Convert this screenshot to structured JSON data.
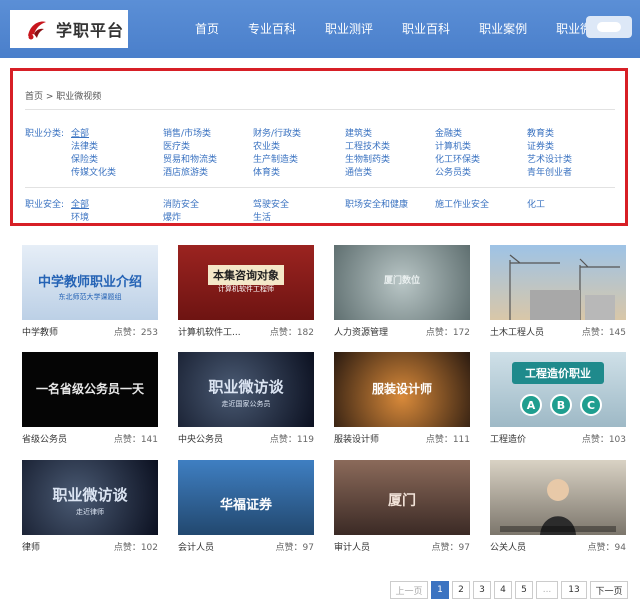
{
  "header": {
    "brand": "学职平台",
    "nav": [
      "首页",
      "专业百科",
      "职业测评",
      "职业百科",
      "职业案例",
      "职业微视频"
    ],
    "accent": "#4a7fcb"
  },
  "breadcrumb": "首页 > 职业微视频",
  "filters": {
    "category_label": "职业分类:",
    "category_items": [
      "全部",
      "销售/市场类",
      "财务/行政类",
      "建筑类",
      "金融类",
      "教育类",
      "法律类",
      "医疗类",
      "农业类",
      "工程技术类",
      "计算机类",
      "证券类",
      "保险类",
      "贸易和物流类",
      "生产制造类",
      "生物制药类",
      "化工环保类",
      "艺术设计类",
      "传媒文化类",
      "酒店旅游类",
      "体育类",
      "通信类",
      "公务员类",
      "青年创业者"
    ],
    "safety_label": "职业安全:",
    "safety_items": [
      "全部",
      "消防安全",
      "驾驶安全",
      "职场安全和健康",
      "施工作业安全",
      "化工",
      "环境",
      "爆炸",
      "生活"
    ],
    "highlight_color": "#d71f26"
  },
  "videos": [
    {
      "title": "中学教师",
      "likes": "点赞：253",
      "thumb_text": "中学教师职业介绍",
      "thumb_sub": "东北师范大学课题组"
    },
    {
      "title": "计算机软件工...",
      "likes": "点赞：182",
      "thumb_text": "本集咨询对象",
      "thumb_sub": "计算机软件工程师"
    },
    {
      "title": "人力资源管理",
      "likes": "点赞：172",
      "thumb_text": "厦门数位",
      "thumb_sub": ""
    },
    {
      "title": "土木工程人员",
      "likes": "点赞：145",
      "thumb_text": "",
      "thumb_sub": ""
    },
    {
      "title": "省级公务员",
      "likes": "点赞：141",
      "thumb_text": "一名省级公务员一天",
      "thumb_sub": ""
    },
    {
      "title": "中央公务员",
      "likes": "点赞：119",
      "thumb_text": "职业微访谈",
      "thumb_sub": "走近国家公务员"
    },
    {
      "title": "服装设计师",
      "likes": "点赞：111",
      "thumb_text": "服装设计师",
      "thumb_sub": ""
    },
    {
      "title": "工程造价",
      "likes": "点赞：103",
      "thumb_text": "工程造价职业",
      "thumb_sub": ""
    },
    {
      "title": "律师",
      "likes": "点赞：102",
      "thumb_text": "职业微访谈",
      "thumb_sub": "走近律师"
    },
    {
      "title": "会计人员",
      "likes": "点赞：97",
      "thumb_text": "华福证券",
      "thumb_sub": ""
    },
    {
      "title": "审计人员",
      "likes": "点赞：97",
      "thumb_text": "厦门",
      "thumb_sub": ""
    },
    {
      "title": "公关人员",
      "likes": "点赞：94",
      "thumb_text": "",
      "thumb_sub": ""
    }
  ],
  "pagination": {
    "prev": "上一页",
    "pages": [
      "1",
      "2",
      "3",
      "4",
      "5",
      "...",
      "13"
    ],
    "current": "1",
    "next": "下一页"
  }
}
